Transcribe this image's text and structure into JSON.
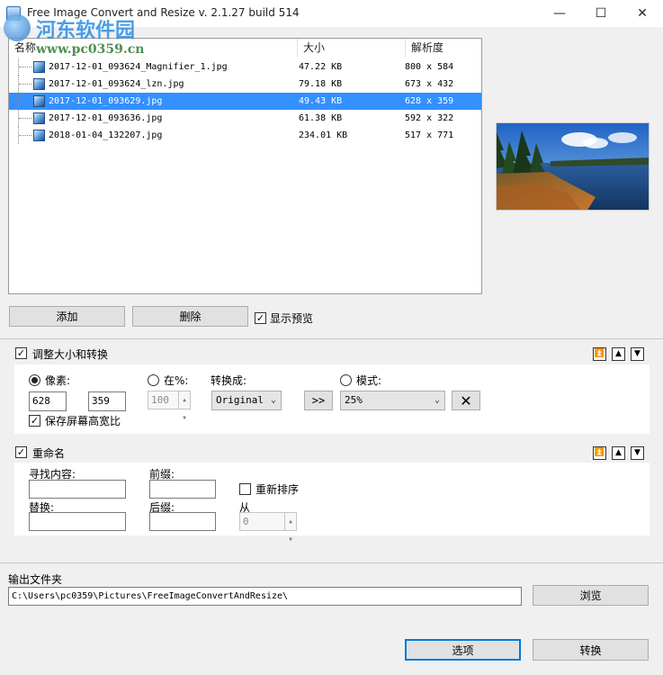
{
  "window": {
    "title": "Free Image Convert and Resize  v. 2.1.27 build 514",
    "minimize": "—",
    "maximize": "☐",
    "close": "✕"
  },
  "watermark": {
    "name": "河东软件园",
    "url": "www.pc0359.cn"
  },
  "file_list": {
    "columns": {
      "name": "名称",
      "size": "大小",
      "resolution": "解析度"
    },
    "rows": [
      {
        "name": "2017-12-01_093624_Magnifier_1.jpg",
        "size": "47.22 KB",
        "resolution": "800 x 584",
        "selected": false
      },
      {
        "name": "2017-12-01_093624_lzn.jpg",
        "size": "79.18 KB",
        "resolution": "673 x 432",
        "selected": false
      },
      {
        "name": "2017-12-01_093629.jpg",
        "size": "49.43 KB",
        "resolution": "628 x 359",
        "selected": true
      },
      {
        "name": "2017-12-01_093636.jpg",
        "size": "61.38 KB",
        "resolution": "592 x 322",
        "selected": false
      },
      {
        "name": "2018-01-04_132207.jpg",
        "size": "234.01 KB",
        "resolution": "517 x 771",
        "selected": false
      }
    ]
  },
  "actions": {
    "add": "添加",
    "delete": "删除",
    "show_preview": "显示预览",
    "show_preview_checked": true
  },
  "resize_panel": {
    "title": "调整大小和转换",
    "enabled": true,
    "pixels_label": "像素:",
    "width": "628",
    "height": "359",
    "percent_label": "在%:",
    "percent_value": "100",
    "convert_label": "转换成:",
    "convert_value": "Original",
    "transfer_btn": ">>",
    "mode_label": "模式:",
    "mode_value": "25%",
    "keep_ratio": "保存屏幕高宽比",
    "keep_ratio_checked": true
  },
  "rename_panel": {
    "title": "重命名",
    "enabled": true,
    "find_label": "寻找内容:",
    "replace_label": "替换:",
    "prefix_label": "前缀:",
    "suffix_label": "后缀:",
    "renumber_label": "重新排序",
    "from_label": "从",
    "from_value": "0"
  },
  "output": {
    "label": "输出文件夹",
    "path": "C:\\Users\\pc0359\\Pictures\\FreeImageConvertAndResize\\",
    "browse": "浏览"
  },
  "footer": {
    "options": "选项",
    "convert": "转换"
  },
  "colors": {
    "selection": "#3390ff",
    "accent": "#0078d7"
  }
}
